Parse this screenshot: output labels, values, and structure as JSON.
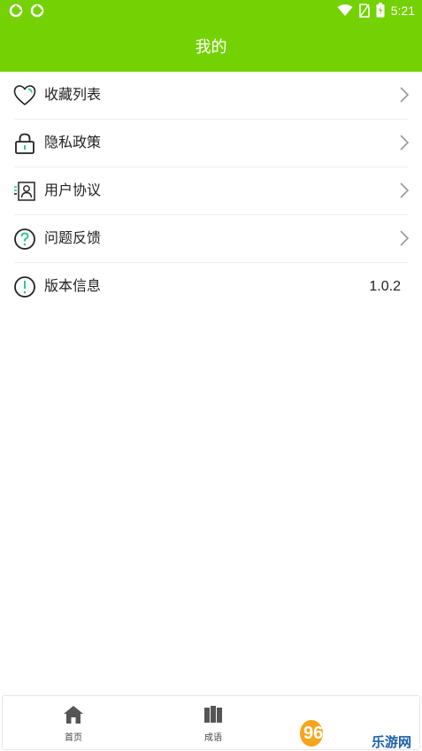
{
  "status_bar": {
    "time": "5:21"
  },
  "header": {
    "title": "我的"
  },
  "menu": {
    "items": [
      {
        "label": "收藏列表",
        "icon": "heart-icon"
      },
      {
        "label": "隐私政策",
        "icon": "lock-icon"
      },
      {
        "label": "用户协议",
        "icon": "user-card-icon"
      },
      {
        "label": "问题反馈",
        "icon": "question-icon"
      },
      {
        "label": "版本信息",
        "icon": "info-icon",
        "value": "1.0.2"
      }
    ]
  },
  "tabbar": {
    "tabs": [
      {
        "label": "首页",
        "icon": "home-icon"
      },
      {
        "label": "成语",
        "icon": "books-icon"
      }
    ]
  },
  "watermark": {
    "text": "962.NET",
    "subtext": "乐游网"
  },
  "colors": {
    "accent": "#74d103",
    "icon_green": "#2ec98a"
  }
}
